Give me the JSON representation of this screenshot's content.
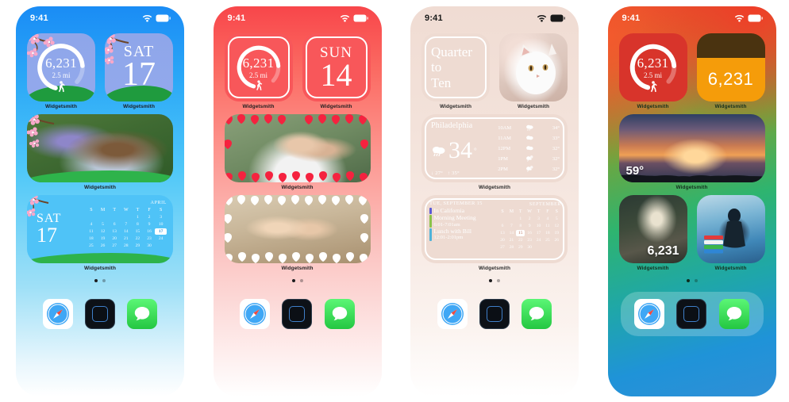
{
  "status_bar": {
    "time": "9:41",
    "wifi_icon": "wifi-icon",
    "battery_icon": "battery-icon"
  },
  "widget_label": "Widgetsmith",
  "phones": [
    {
      "id": "phone-spring-blue",
      "theme_color": "#4fc3f7",
      "widgets": [
        {
          "name": "steps-ring-widget",
          "steps": "6,231",
          "distance": "2.5 mi",
          "icon": "walking-person-icon"
        },
        {
          "name": "date-widget",
          "weekday": "SAT",
          "day": "17",
          "decoration": "cherry-blossom-icon"
        },
        {
          "name": "photo-widget-garden",
          "caption": ""
        },
        {
          "name": "calendar-widget",
          "weekday": "SAT",
          "day": "17",
          "month": "APRIL",
          "weekday_headers": [
            "S",
            "M",
            "T",
            "W",
            "T",
            "F",
            "S"
          ],
          "cells": [
            "",
            "",
            "",
            "",
            "1",
            "2",
            "3",
            "4",
            "5",
            "6",
            "7",
            "8",
            "9",
            "10",
            "11",
            "12",
            "13",
            "14",
            "15",
            "16",
            "17",
            "18",
            "19",
            "20",
            "21",
            "22",
            "23",
            "24",
            "25",
            "26",
            "27",
            "28",
            "29",
            "30",
            ""
          ],
          "today": "17"
        }
      ]
    },
    {
      "id": "phone-valentine-red",
      "theme_color": "#f8575a",
      "widgets": [
        {
          "name": "steps-ring-widget",
          "steps": "6,231",
          "distance": "2.5 mi",
          "icon": "walking-person-icon"
        },
        {
          "name": "date-widget",
          "weekday": "SUN",
          "day": "14"
        },
        {
          "name": "photo-widget-couple",
          "caption": ""
        },
        {
          "name": "photo-widget-hammock",
          "caption": ""
        }
      ]
    },
    {
      "id": "phone-blush-beige",
      "theme_color": "#eedbd2",
      "widgets": [
        {
          "name": "clock-words-widget",
          "lines": [
            "Quarter",
            "to",
            "Ten"
          ]
        },
        {
          "name": "photo-widget-cat",
          "caption": ""
        },
        {
          "name": "weather-widget",
          "city": "Philadelphia",
          "temperature": "34",
          "degree": "°",
          "low": "↓ 27°",
          "high": "↑ 35°",
          "condition_icon": "rain-cloud-icon",
          "hourly": [
            {
              "hour": "10AM",
              "icon": "rain-cloud-icon",
              "temp": "34°"
            },
            {
              "hour": "11AM",
              "icon": "cloud-icon",
              "temp": "33°"
            },
            {
              "hour": "12PM",
              "icon": "cloud-icon",
              "temp": "32°"
            },
            {
              "hour": "1PM",
              "icon": "sun-cloud-rain-icon",
              "temp": "32°"
            },
            {
              "hour": "2PM",
              "icon": "sun-cloud-rain-icon",
              "temp": "32°"
            }
          ]
        },
        {
          "name": "calendar-events-widget",
          "header": "TUE, SEPTEMBER 15",
          "month": "SEPTEMBER",
          "weekday_headers": [
            "S",
            "M",
            "T",
            "W",
            "T",
            "F",
            "S"
          ],
          "cells": [
            "",
            "",
            "1",
            "2",
            "3",
            "4",
            "5",
            "6",
            "7",
            "8",
            "9",
            "10",
            "11",
            "12",
            "13",
            "14",
            "15",
            "16",
            "17",
            "18",
            "19",
            "20",
            "21",
            "22",
            "23",
            "24",
            "25",
            "26",
            "27",
            "28",
            "29",
            "30",
            "",
            "",
            ""
          ],
          "today": "15",
          "events": [
            {
              "title": "In California",
              "time": "",
              "color": "#5b5bd6"
            },
            {
              "title": "Morning Meeting",
              "time": "6:01-7:01am",
              "color": "#8bc34a"
            },
            {
              "title": "Lunch with Bill",
              "time": "12:01-2:01pm",
              "color": "#4fb3d9"
            }
          ]
        }
      ]
    },
    {
      "id": "phone-rainbow-gradient",
      "theme_color": "#d8402a",
      "widgets": [
        {
          "name": "steps-ring-widget",
          "steps": "6,231",
          "distance": "2.5 mi",
          "icon": "walking-person-icon"
        },
        {
          "name": "steps-count-widget",
          "steps": "6,231",
          "top_color": "#4a3310",
          "bottom_color": "#f59c0a"
        },
        {
          "name": "photo-widget-sunset",
          "overlay_temp": "59°"
        },
        {
          "name": "photo-widget-forest",
          "overlay_steps": "6,231"
        },
        {
          "name": "photo-widget-aquarium",
          "icon": "books-icon"
        }
      ]
    }
  ],
  "page_dots": {
    "total": 2,
    "active_index": 0
  },
  "dock": {
    "apps": [
      {
        "name": "safari-app-icon",
        "label": "Safari"
      },
      {
        "name": "widgetsmith-app-icon",
        "label": "Widgetsmith"
      },
      {
        "name": "messages-app-icon",
        "label": "Messages"
      }
    ]
  }
}
